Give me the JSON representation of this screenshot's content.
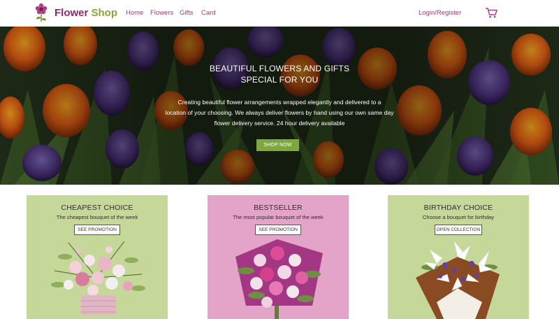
{
  "header": {
    "brand_part1": "Flower",
    "brand_part2": "Shop",
    "nav": [
      "Home",
      "Flowers",
      "Gifts",
      "Card"
    ],
    "login": "Login/Register",
    "cart_icon": "shopping-cart-icon",
    "logo_icon": "flower-logo-icon"
  },
  "hero": {
    "title_line1": "BEAUTIFUL FLOWERS AND GIFTS",
    "title_line2": "SPECIAL FOR YOU",
    "desc_line1": "Creating beautiful flower arrangements wrapped elegantly and delivered to a",
    "desc_line2": "location of your choosing. We always deliver flowers by hand using our own same day",
    "desc_line3": "flower delivery service. 24 hour delivery available",
    "button": "SHOP NOW"
  },
  "cards": [
    {
      "title": "CHEAPEST CHOICE",
      "subtitle": "The cheapest bouquet of the week",
      "button": "SEE PROMOTION",
      "bg": "#c5d89a"
    },
    {
      "title": "BESTSELLER",
      "subtitle": "The most popular bouquet of the week",
      "button": "SEE PROMOTION",
      "bg": "#e4a3c9"
    },
    {
      "title": "BIRTHDAY CHOICE",
      "subtitle": "Choose a bouquet for birthday",
      "button": "OPEN COLLECTION",
      "bg": "#c5d89a"
    }
  ],
  "colors": {
    "brand_purple": "#8e2a64",
    "brand_green": "#86a63a",
    "nav_text": "#9c3f70",
    "button_green": "#7ea83b"
  }
}
